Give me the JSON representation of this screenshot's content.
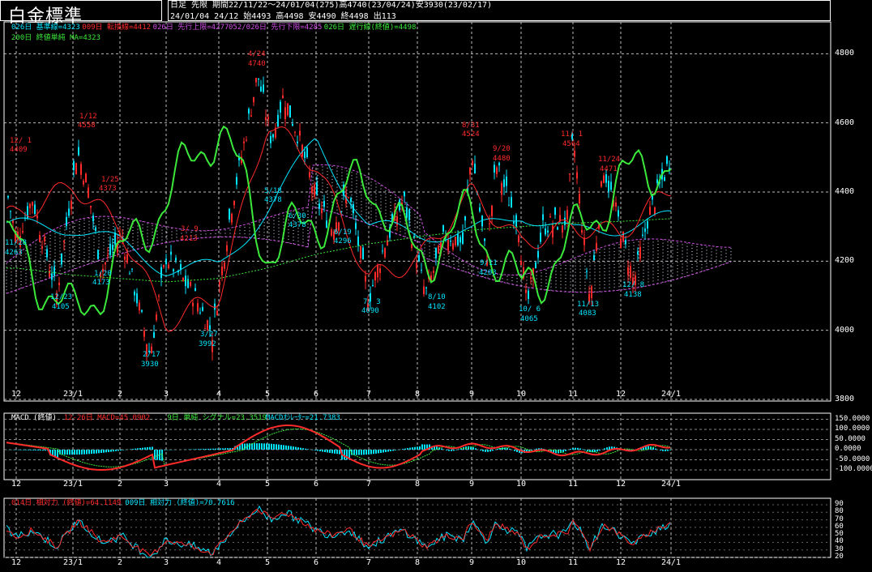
{
  "header": {
    "title": "白金標準",
    "info_line1": "日足  先限  期間22/11/22～24/01/04(275)高4740(23/04/24)安3930(23/02/17)",
    "info_line2": "24/01/04 24/12 始4493 高4498 安4490 終4498 出113"
  },
  "legend_main": {
    "line1": [
      {
        "text": "026日 基準線=4323",
        "color": "#00e5ff"
      },
      {
        "text": "009日 転換線=4412",
        "color": "#ff2a2a"
      },
      {
        "text": "026日 先行上限=4277",
        "color": "#d04de6"
      },
      {
        "text": "052/026日 先行下限=4285",
        "color": "#d04de6"
      },
      {
        "text": "026日 遅行線(終値)=4498",
        "color": "#3be93b"
      }
    ],
    "line2": [
      {
        "text": "200日 終値単純 MA=4323",
        "color": "#3be93b"
      }
    ]
  },
  "legend_macd": [
    {
      "text": "MACD (終値)",
      "color": "#ffffff"
    },
    {
      "text": "12-26日 MACD=45.0902",
      "color": "#ff2a2a"
    },
    {
      "text": "9日 単純 シグナル=23.3519",
      "color": "#3be93b"
    },
    {
      "text": "MACDｵｼﾚｰﾀｰ=21.7383",
      "color": "#00e5ff"
    }
  ],
  "legend_rsi": [
    {
      "text": "014日 相対力 (終値)=64.1149",
      "color": "#ff2a2a"
    },
    {
      "text": "009日 相対力 (終値)=70.7616",
      "color": "#00e5ff"
    }
  ],
  "x_labels": [
    "12",
    "23/1",
    "2",
    "3",
    "4",
    "5",
    "6",
    "7",
    "8",
    "9",
    "10",
    "11",
    "12",
    "24/1"
  ],
  "y_main_ticks": [
    "4800",
    "4600",
    "4400",
    "4200",
    "4000",
    "3800"
  ],
  "y_macd_ticks": [
    "150.0000",
    "100.0000",
    "50.0000",
    "0.0000",
    "-50.0000",
    "-100.0000"
  ],
  "y_rsi_ticks": [
    "90",
    "80",
    "70",
    "60",
    "50",
    "40",
    "30",
    "20"
  ],
  "annotations": [
    {
      "text": "12/ 1",
      "color": "#ff2a2a"
    },
    {
      "text": "4409",
      "color": "#ff2a2a"
    },
    {
      "text": "1/12",
      "color": "#ff2a2a"
    },
    {
      "text": "4558",
      "color": "#ff2a2a"
    },
    {
      "text": "1/25",
      "color": "#ff2a2a"
    },
    {
      "text": "4373",
      "color": "#ff2a2a"
    },
    {
      "text": "11/28",
      "color": "#00e5ff"
    },
    {
      "text": "4263",
      "color": "#00e5ff"
    },
    {
      "text": "12/23",
      "color": "#00e5ff"
    },
    {
      "text": "4105",
      "color": "#00e5ff"
    },
    {
      "text": "1/20",
      "color": "#00e5ff"
    },
    {
      "text": "4173",
      "color": "#00e5ff"
    },
    {
      "text": "2/17",
      "color": "#00e5ff"
    },
    {
      "text": "3930",
      "color": "#00e5ff"
    },
    {
      "text": "3/ 9",
      "color": "#ff2a2a"
    },
    {
      "text": "4213",
      "color": "#ff2a2a"
    },
    {
      "text": "3/27",
      "color": "#00e5ff"
    },
    {
      "text": "3992",
      "color": "#00e5ff"
    },
    {
      "text": "4/24",
      "color": "#ff2a2a"
    },
    {
      "text": "4740",
      "color": "#ff2a2a"
    },
    {
      "text": "5/18",
      "color": "#00e5ff"
    },
    {
      "text": "4378",
      "color": "#00e5ff"
    },
    {
      "text": "6/30",
      "color": "#00e5ff"
    },
    {
      "text": "4378",
      "color": "#00e5ff"
    },
    {
      "text": "6/19",
      "color": "#00e5ff"
    },
    {
      "text": "4296",
      "color": "#00e5ff"
    },
    {
      "text": "7/ 3",
      "color": "#00e5ff"
    },
    {
      "text": "4090",
      "color": "#00e5ff"
    },
    {
      "text": "8/10",
      "color": "#00e5ff"
    },
    {
      "text": "4102",
      "color": "#00e5ff"
    },
    {
      "text": "8/31",
      "color": "#ff2a2a"
    },
    {
      "text": "4524",
      "color": "#ff2a2a"
    },
    {
      "text": "9/20",
      "color": "#ff2a2a"
    },
    {
      "text": "4480",
      "color": "#ff2a2a"
    },
    {
      "text": "9/11",
      "color": "#00e5ff"
    },
    {
      "text": "4203",
      "color": "#00e5ff"
    },
    {
      "text": "10/ 6",
      "color": "#00e5ff"
    },
    {
      "text": "4065",
      "color": "#00e5ff"
    },
    {
      "text": "11/ 1",
      "color": "#ff2a2a"
    },
    {
      "text": "4564",
      "color": "#ff2a2a"
    },
    {
      "text": "11/24",
      "color": "#ff2a2a"
    },
    {
      "text": "4471",
      "color": "#ff2a2a"
    },
    {
      "text": "11/13",
      "color": "#00e5ff"
    },
    {
      "text": "4083",
      "color": "#00e5ff"
    },
    {
      "text": "12/ 8",
      "color": "#00e5ff"
    },
    {
      "text": "4138",
      "color": "#00e5ff"
    }
  ],
  "chart_data": {
    "type": "line",
    "panels": [
      "price-ichimoku",
      "macd",
      "rsi"
    ],
    "price_ylim": [
      3800,
      4850
    ],
    "x_categories": [
      "12",
      "23/1",
      "2",
      "3",
      "4",
      "5",
      "6",
      "7",
      "8",
      "9",
      "10",
      "11",
      "12",
      "24/1"
    ],
    "series": [
      {
        "name": "026日 基準線",
        "color": "#00e5ff",
        "values": [
          4300,
          4300,
          4250,
          4180,
          4180,
          4350,
          4550,
          4300,
          4280,
          4280,
          4340,
          4280,
          4300,
          4323
        ]
      },
      {
        "name": "009日 転換線",
        "color": "#ff2a2a",
        "values": [
          4330,
          4420,
          4300,
          4020,
          4100,
          4600,
          4480,
          4150,
          4200,
          4400,
          4250,
          4300,
          4280,
          4412
        ]
      },
      {
        "name": "026日 遅行線(終値)",
        "color": "#3be93b",
        "values": [
          4240,
          4030,
          4200,
          4380,
          4600,
          4230,
          4320,
          4440,
          4200,
          4330,
          4110,
          4260,
          4430,
          4498
        ]
      },
      {
        "name": "200日 終値単純 MA",
        "color": "#3be93b",
        "values": [
          4180,
          4160,
          4150,
          4140,
          4150,
          4180,
          4220,
          4250,
          4270,
          4290,
          4300,
          4310,
          4315,
          4323
        ]
      }
    ],
    "macd": {
      "macd": 45.0902,
      "signal": 23.3519,
      "oscillator": 21.7383
    },
    "rsi": {
      "rsi14": 64.1149,
      "rsi9": 70.7616
    }
  }
}
